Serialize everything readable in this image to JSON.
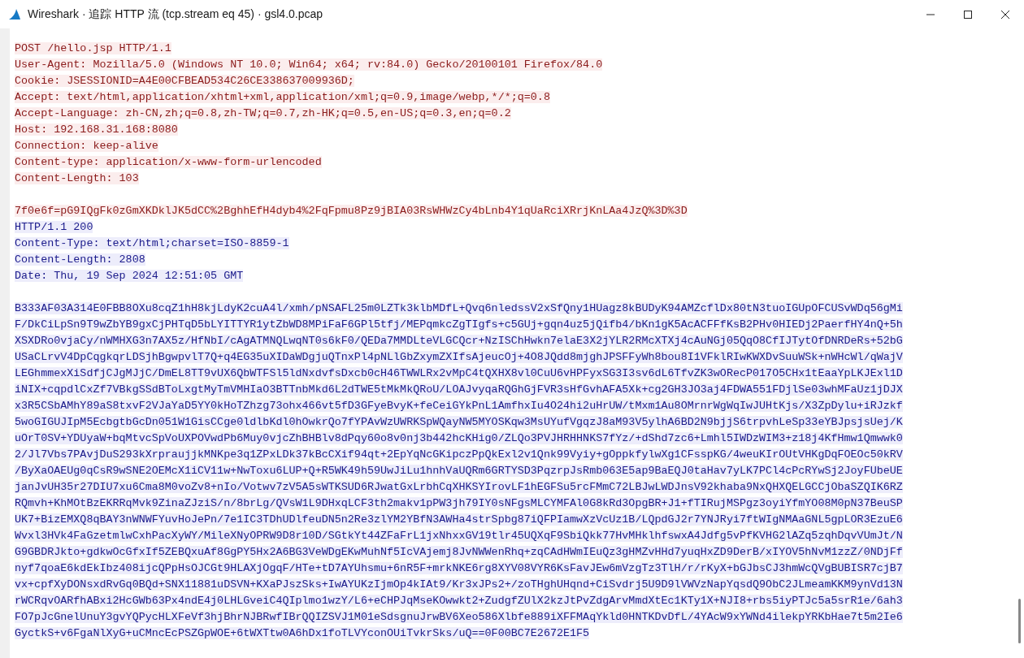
{
  "window": {
    "title": "Wireshark · 追踪 HTTP 流 (tcp.stream eq 45) · gsl4.0.pcap"
  },
  "blocks": [
    {
      "kind": "client",
      "lines": [
        "POST /hello.jsp HTTP/1.1",
        "User-Agent: Mozilla/5.0 (Windows NT 10.0; Win64; x64; rv:84.0) Gecko/20100101 Firefox/84.0",
        "Cookie: JSESSIONID=A4E00CFBEAD534C26CE338637009936D;",
        "Accept: text/html,application/xhtml+xml,application/xml;q=0.9,image/webp,*/*;q=0.8",
        "Accept-Language: zh-CN,zh;q=0.8,zh-TW;q=0.7,zh-HK;q=0.5,en-US;q=0.3,en;q=0.2",
        "Host: 192.168.31.168:8080",
        "Connection: keep-alive",
        "Content-type: application/x-www-form-urlencoded",
        "Content-Length: 103"
      ]
    },
    {
      "kind": "client",
      "lines": [
        "7f0e6f=pG9IQgFk0zGmXKDklJK5dCC%2BghhEfH4dyb4%2FqFpmu8Pz9jBIA03RsWHWzCy4bLnb4Y1qUaRciXRrjKnLAa4JzQ%3D%3D"
      ]
    },
    {
      "kind": "server",
      "lines": [
        "HTTP/1.1 200",
        "Content-Type: text/html;charset=ISO-8859-1",
        "Content-Length: 2808",
        "Date: Thu, 19 Sep 2024 12:51:05 GMT"
      ]
    },
    {
      "kind": "server",
      "lines": [
        "B333AF03A314E0FBB8OXu8cqZ1hH8kjLdyK2cuA4l/xmh/pNSAFL25m0LZTk3klbMDfL+Qvq6nledssV2xSfQny1HUagz8kBUDyK94AMZcflDx80tN3tuoIGUpOFCUSvWDq56gMi",
        "F/DkCiLpSn9T9wZbYB9gxCjPHTqD5bLYITTYR1ytZbWD8MPiFaF6GPl5tfj/MEPqmkcZgTIgfs+c5GUj+gqn4uz5jQifb4/bKn1gK5AcACFFfKsB2PHv0HIEDj2PaerfHY4nQ+5h",
        "XSXDRo0vjaCy/nWMHXG3n7AX5z/HfNbI/cAgATMNQLwqNT0s6kF0/QEDa7MMDLteVLGCQcr+NzISChHwkn7elaE3X2jYLR2RMcXTXj4cAuNGj05QqO8CfIJTytOfDNRDeRs+52bG",
        "USaCLrvV4DpCqgkqrLDSjhBgwpvlT7Q+q4EG35uXIDaWDgjuQTnxPl4pNLlGbZxymZXIfsAjeucOj+4O8JQdd8mjghJPSFFyWh8bou8I1VFklRIwKWXDvSuuWSk+nWHcWl/qWajV",
        "LEGhmmexXiSdfjCJgMJjC/DmEL8TT9vUX6QbWTFSl5ldNxdvfsDxcb0cH46TWWLRx2vMpC4tQXHX8vl0CuU6vHPFyxSG3I3sv6dL6TfvZK3wORecP017O5CHx1tEaaYpLKJExl1D",
        "iNIX+cqpdlCxZf7VBkgSSdBToLxgtMyTmVMHIaO3BTTnbMkd6L2dTWE5tMkMkQRoU/LOAJvyqaRQGhGjFVR3sHfGvhAFA5Xk+cg2GH3JO3aj4FDWA551FDjlSe03whMFaUz1jDJX",
        "x3R5CSbAMhY89aS8txvF2VJaYaD5YY0kHoTZhzg73ohx466vt5fD3GFyeBvyK+feCeiGYkPnL1AmfhxIu4O24hi2uHrUW/tMxm1Au8OMrnrWgWqIwJUHtKjs/X3ZpDylu+iRJzkf",
        "5woGIGUJIpM5EcbgtbGcDn051W1GisCCge0ldlbKdl0hOwkrQo7fYPAvWzUWRKSpWQayNW5MYOSKqw3MsUYufVgqzJ8aM93V5ylhA6BD2N9bjjS6trpvhLeSp33eYBJpsjsUej/K",
        "uOrT0SV+YDUyaW+bqMtvcSpVoUXPOVwdPb6Muy0vjcZhBHBlv8dPqy60o8v0nj3b442hcKHig0/ZLQo3PVJHRHHNKS7fYz/+dShd7zc6+Lmhl5IWDzWIM3+z18j4KfHmw1Qmwwk0",
        "2/Jl7Vbs7PAvjDuS293kXrpraujjkMNKpe3q1ZPxLDk37kBcCXif94qt+2EpYqNcGKipczPpQkExl2v1Qnk99Vyiy+gOppkfylwXg1CFsspKG/4weuKIrOUtVHKgDqFOEOc50kRV",
        "/ByXaOAEUg0qCsR9wSNE2OEMcX1iCV11w+NwToxu6LUP+Q+R5WK49h59UwJiLu1hnhVaUQRm6GRTYSD3PqzrpJsRmb063E5ap9BaEQJ0taHav7yLK7PCl4cPcRYwSj2JoyFUbeUE",
        "janJvUH35r27DIU7xu6Cma8M0voZv8+nIo/Votwv7zV5A5sWTKSUD6RJwatGxLrbhCqXHKSYIrovLF1hEGFSu5rcFMmC72LBJwLWDJnsV92khaba9NxQHXQELGCCjObaSZQIK6RZ",
        "RQmvh+KhMOtBzEKRRqMvk9ZinaZJziS/n/8brLg/QVsW1L9DHxqLCF3th2makv1pPW3jh79IY0sNFgsMLCYMFAl0G8kRd3OpgBR+J1+fTIRujMSPgz3oyiYfmYO08M0pN37BeuSP",
        "UK7+BizEMXQ8qBAY3nWNWFYuvHoJePn/7e1IC3TDhUDlfeuDN5n2Re3zlYM2YBfN3AWHa4strSpbg87iQFPIamwXzVcUz1B/LQpdGJ2r7YNJRyi7ftWIgNMAaGNL5gpLOR3EzuE6",
        "Wvxl3HVk4FaGzetmlwCxhPacXyWY/MileXNyOPRW9D8r10D/SGtkYt44ZFaFrL1jxNhxxGV19tlr45UQXqF9SbiQkk77HvMHklhfswxA4Jdfg5vPfKVHG2lAZq5zqhDqvVUmJt/N",
        "G9GBDRJkto+gdkwOcGfxIf5ZEBQxuAf8GgPY5Hx2A6BG3VeWDgEKwMuhNf5IcVAjemj8JvNWWenRhq+zqCAdHWmIEuQz3gHMZvHHd7yuqHxZD9DerB/xIYOV5hNvM1zzZ/0NDjFf",
        "nyf7qoaE6kdEkIbz408ijcQPpHsOJCGt9HLAXjOgqF/HTe+tD7AYUhsmu+6nR5F+mrkNKE6rg8XYV08VYR6KsFavJEw6mVzgTz3TlH/r/rKyX+bGJbsCJ3hmWcQVgBUBISR7cjB7",
        "vx+cpfXyDONsxdRvGq0BQd+SNX11881uDSVN+KXaPJszSks+IwAYUKzIjmOp4kIAt9/Kr3xJPs2+/zoTHghUHqnd+CiSvdrj5U9D9lVWVzNapYqsdQ9ObC2JLmeamKKM9ynVd13N",
        "rWCRqvOARfhABxi2HcGWb63Px4ndE4j0LHLGveiC4QIplmo1wzY/L6+eCHPJqMseKOwwkt2+ZudgfZUlX2kzJtPvZdgArvMmdXtEc1KTy1X+NJI8+rbs5iyPTJc5a5srR1e/6ah3",
        "FO7pJcGnelUnuY3gvYQPycHLXFeVf3hjBhrNJBRwfIBrQQIZSVJ1M01eSdsgnuJrwBV6Xeo586Xlbfe889iXFFMAqYkld0HNTKDvDfL/4YAcW9xYWNd4ilekpYRKbHae7t5m2Ie6",
        "GyctkS+v6FgaNlXyG+uCMncEcPSZGpWOE+6tWXTtw0A6hDx1foTLVYconOUiTvkrSks/uQ==0F00BC7E2672E1F5"
      ]
    }
  ]
}
